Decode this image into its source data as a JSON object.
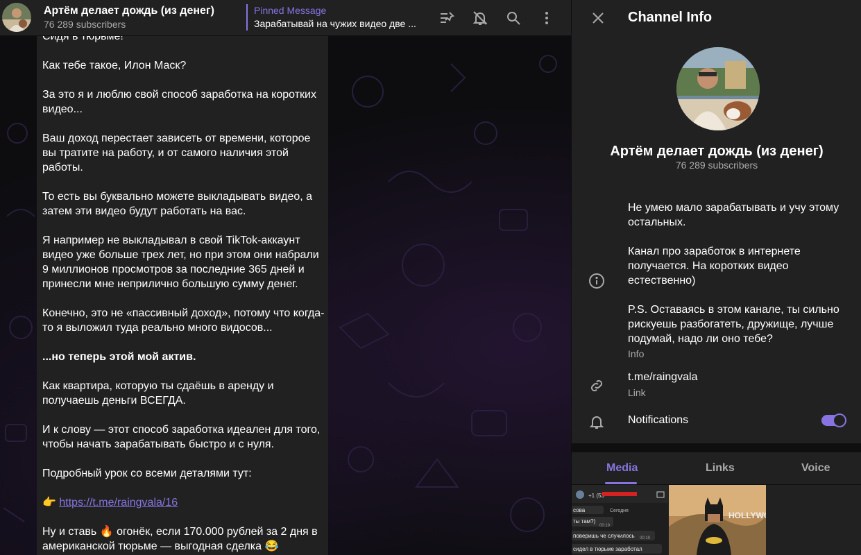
{
  "header": {
    "channel_title": "Артём делает дождь (из денег)",
    "subscribers": "76 289 subscribers",
    "pinned_label": "Pinned Message",
    "pinned_text": "Зарабатывай на чужих видео две ..."
  },
  "message": {
    "paragraphs": [
      "Сидя в тюрьме!",
      "Как тебе такое, Илон Маск?",
      "За это я и люблю свой способ заработка на коротких видео...",
      "Ваш доход перестает зависеть от времени, которое вы тратите на работу, и от самого наличия этой работы.",
      "То есть вы буквально можете выкладывать видео, а затем эти видео будут работать на вас.",
      "Я например не выкладывал в свой TikTok-аккаунт видео уже больше трех лет, но при этом они набрали 9 миллионов просмотров за последние 365 дней и принесли мне неприлично большую сумму денег.",
      "Конечно, это не «пассивный доход», потому что когда-то я выложил туда реально много видосов...",
      "...но теперь этой мой актив.",
      "Как квартира, которую ты сдаёшь в аренду и получаешь деньги ВСЕГДА.",
      "И к слову — этот способ заработка идеален для того, чтобы начать зарабатывать быстро и с нуля.",
      "Подробный урок со всеми деталями тут:",
      "Ну и ставь 🔥 огонёк, если 170.000 рублей за 2 дня в американской тюрьме — выгодная сделка 😂"
    ],
    "link_emoji": "👉",
    "link_url": "https://t.me/raingvala/16"
  },
  "panel": {
    "title": "Channel Info",
    "channel_name": "Артём делает дождь (из денег)",
    "subscribers": "76 289 subscribers",
    "info_paragraphs": [
      "Не умею мало зарабатывать и учу этому остальных.",
      "Канал про заработок в интернете получается. На коротких видео естественно)",
      "P.S. Оставаясь в этом канале, ты сильно рискуешь разбогатеть, дружище, лучше подумай, надо ли оно тебе?"
    ],
    "info_label": "Info",
    "link": "t.me/raingvala",
    "link_label": "Link",
    "notifications_label": "Notifications",
    "notifications_on": true,
    "tabs": [
      "Media",
      "Links",
      "Voice"
    ],
    "active_tab": "Media",
    "thumb1": {
      "name": "+1 (53",
      "rows": [
        "сова",
        "Сегодня",
        "00:19",
        "ты там?)",
        "00:19",
        "поверишь че случилось",
        "00:19",
        "сидел в тюрьме заработал"
      ]
    },
    "thumb2_text": "HOLLYWO"
  },
  "icons": [
    "channel-avatar",
    "unpin-list-icon",
    "mute-bell-icon",
    "search-icon",
    "more-vertical-icon",
    "close-icon",
    "info-icon",
    "link-icon",
    "bell-icon"
  ],
  "colors": {
    "accent": "#8774e1",
    "panel_bg": "#212121",
    "muted_text": "#aaaaaa",
    "chat_bg": "#0d0d10"
  }
}
